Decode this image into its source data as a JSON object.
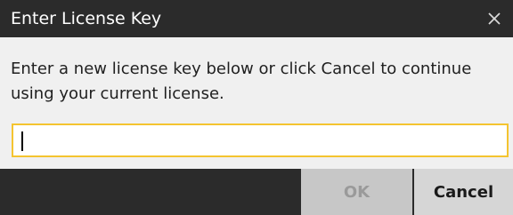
{
  "dialog": {
    "title": "Enter License Key",
    "close_icon": "close-icon",
    "message": "Enter a new license key below or click Cancel to continue using your current license.",
    "input": {
      "value": "",
      "placeholder": ""
    },
    "buttons": {
      "ok_label": "OK",
      "cancel_label": "Cancel"
    },
    "colors": {
      "titlebar": "#2b2b2b",
      "input_border": "#f4c430",
      "ok_background": "#c7c7c7",
      "cancel_background": "#d6d6d6"
    }
  }
}
